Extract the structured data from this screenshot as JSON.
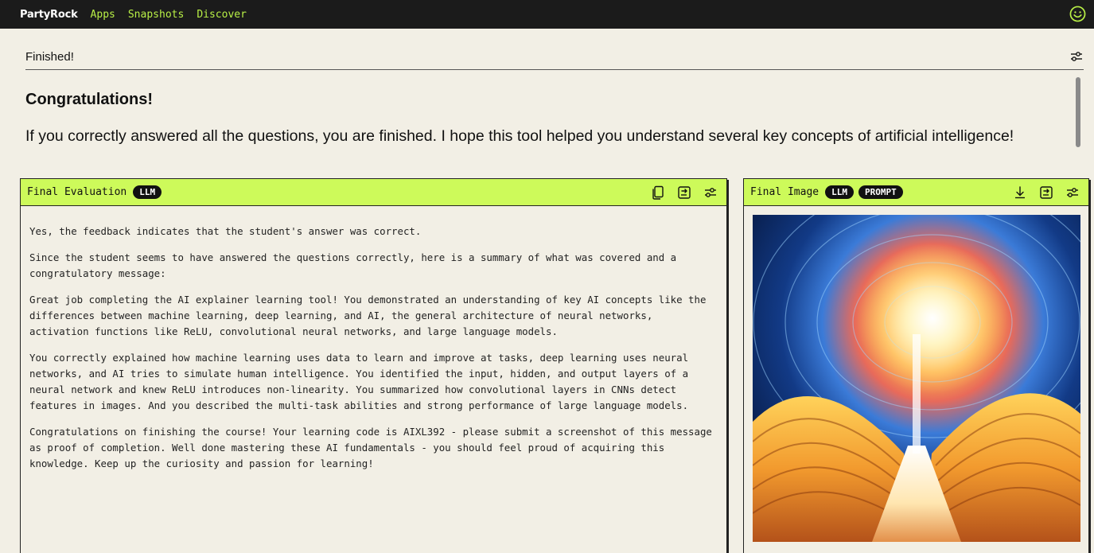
{
  "nav": {
    "brand": "PartyRock",
    "links": [
      "Apps",
      "Snapshots",
      "Discover"
    ]
  },
  "icons": {
    "user": "smiley-icon",
    "settings": "sliders-icon",
    "copy": "copy-icon",
    "share": "share-icon",
    "download": "download-icon"
  },
  "section": {
    "title": "Finished!"
  },
  "intro": {
    "title": "Congratulations!",
    "text": "If you correctly answered all the questions, you are finished. I hope this tool helped you understand several key concepts of artificial intelligence!"
  },
  "evaluation": {
    "title": "Final Evaluation",
    "badge": "LLM",
    "paragraphs": [
      "Yes, the feedback indicates that the student's answer was correct.",
      "Since the student seems to have answered the questions correctly, here is a summary of what was covered and a congratulatory message:",
      "Great job completing the AI explainer learning tool! You demonstrated an understanding of key AI concepts like the differences between machine learning, deep learning, and AI, the general architecture of neural networks, activation functions like ReLU, convolutional neural networks, and large language models.",
      "You correctly explained how machine learning uses data to learn and improve at tasks, deep learning uses neural networks, and AI tries to simulate human intelligence. You identified the input, hidden, and output layers of a neural network and knew ReLU introduces non-linearity. You summarized how convolutional layers in CNNs detect features in images. And you described the multi-task abilities and strong performance of large language models.",
      "Congratulations on finishing the course! Your learning code is AIXL392 - please submit a screenshot of this message as proof of completion. Well done mastering these AI fundamentals - you should feel proud of acquiring this knowledge. Keep up the curiosity and passion for learning!"
    ]
  },
  "image": {
    "title": "Final Image",
    "badges": [
      "LLM",
      "PROMPT"
    ]
  },
  "colors": {
    "topbar": "#1b1b1b",
    "accent": "#b8ef46",
    "card_header": "#cdfa5a",
    "background": "#f2efe5"
  }
}
